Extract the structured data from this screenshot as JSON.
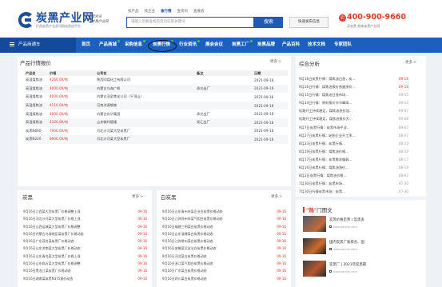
{
  "header": {
    "logo_name": "炭黑产业网",
    "logo_sub": "打造炭黑产业资讯网站首选平台",
    "slogan_line1": "炭黑资讯",
    "slogan_line2": "上炭黑产业网",
    "search_tabs": [
      "找产品",
      "找企业",
      "查行情",
      "查资讯",
      "查展会"
    ],
    "active_tab_index": 2,
    "search_placeholder": "请输入您要查找的资讯任意关键词",
    "search_button": "搜索",
    "publish_button": "快速发布信息",
    "phone": "400-900-9660",
    "phone_sub": "买炭黑 就来炭黑产业网",
    "phone_icon": "phone-icon"
  },
  "nav": {
    "category_label": "产品商通车",
    "items": [
      {
        "label": "首页",
        "new": false
      },
      {
        "label": "产品商城",
        "new": true
      },
      {
        "label": "采购信息",
        "new": true
      },
      {
        "label": "炭黑行情",
        "new": true
      },
      {
        "label": "行业资讯",
        "new": true
      },
      {
        "label": "展会会议",
        "new": false
      },
      {
        "label": "炭黑工厂",
        "new": true
      },
      {
        "label": "炭黑品牌",
        "new": false
      },
      {
        "label": "产品百科",
        "new": false
      },
      {
        "label": "技术文档",
        "new": false
      },
      {
        "label": "专家团队",
        "new": false
      }
    ],
    "highlighted_index": 3
  },
  "price_panel": {
    "title": "产品行情报价",
    "more": "更多 >",
    "columns": [
      "产品名",
      "价格",
      "公司名",
      "备注",
      "日期"
    ],
    "rows": [
      [
        "高温煤焦油",
        "4260.00/吨",
        "陕西同煤化工有限公司",
        "",
        "2021-09-16"
      ],
      [
        "高温煤焦油",
        "4000.00/吨",
        "内蒙古乌海广辉",
        "承兑出厂",
        "2021-09-16"
      ],
      [
        "高温煤焦油",
        "4000.00/吨",
        "内蒙古亚泉焦化公司（平顶山）",
        "",
        "2021-09-16"
      ],
      [
        "高温煤焦油",
        "4110.00/吨",
        "河南济源钢铁",
        "",
        "2021-09-16"
      ],
      [
        "高温煤焦油",
        "4000.00/吨",
        "内蒙古庆华集团",
        "承兑出厂",
        "2021-09-16"
      ],
      [
        "高温煤焦油",
        "4326.00/吨",
        "山东微利德隆",
        "现汇出厂",
        "2021-09-16"
      ],
      [
        "炭黑N660",
        "7900.00/吨",
        "河北沙河某大型炭黑厂",
        "",
        "2021-09-16"
      ],
      [
        "炭黑N220",
        "8900.00/吨",
        "河北沙河某大型炭黑厂",
        "",
        "2021-09-16"
      ]
    ]
  },
  "summary_panel": {
    "title": "综合分析",
    "more": "更多 >",
    "items": [
      {
        "title": "9月16日炭黑行情：煤焦油日涨，炭...",
        "date": "09-16"
      },
      {
        "title": "9月16日行情：煤焦油报价普遍涨价...",
        "date": "09-16"
      },
      {
        "title": "9月15日行情：煤焦油日涨市场...",
        "date": "09-15"
      },
      {
        "title": "9月14日行情：原料报价节节攀高...",
        "date": "09-14"
      },
      {
        "title": "松散开工持续稳定，煤焦油涨价加...",
        "date": "09-07"
      },
      {
        "title": "松散开工持续稳定，煤焦油报价大...",
        "date": "09-08"
      },
      {
        "title": "9月7日炭黑行情：炭黑市场平淡...",
        "date": "09-07"
      },
      {
        "title": "8月27日炭黑行情：轮胎企业开工率...",
        "date": "08-27"
      },
      {
        "title": "8月23日炭黑行情：炭黑行情...",
        "date": "08-23"
      },
      {
        "title": "8月19日炭黑行情：煤焦油价格...",
        "date": "08-19"
      },
      {
        "title": "8月17日炭黑行情：炭黑需求偏弱...",
        "date": "08-17"
      },
      {
        "title": "8月16日炭黑行情：煤焦油涨价...",
        "date": "08-16"
      },
      {
        "title": "8月2日炭黑行情：煤焦油价格...",
        "date": "08-02"
      },
      {
        "title": "7月30日炭黑行情：炭黑市场...",
        "date": "07-30"
      },
      {
        "title": "7月30日行情炭黑市场：炭黑...",
        "date": "07-30"
      }
    ]
  },
  "carbon_black_panel": {
    "title": "炭黑",
    "more": "更多 >",
    "items": [
      {
        "title": "9月16日江西某大型炭黑厂价格调整上涨",
        "date": "09-16"
      },
      {
        "title": "9月16日河北沙河某大型炭黑厂价格上涨",
        "date": "09-16"
      },
      {
        "title": "9月16日山西运城某大型炭黑厂价格调整",
        "date": "09-16"
      },
      {
        "title": "9月16日内蒙古乌海地区某炭黑厂价格动态",
        "date": "09-16"
      },
      {
        "title": "9月16日广东茂名某炭黑厂价格动态",
        "date": "09-16"
      },
      {
        "title": "9月16日山东济南某大型炭黑厂价格动态",
        "date": "09-16"
      },
      {
        "title": "9月16日山东青岛某大型炭黑厂价格上涨",
        "date": "09-16"
      },
      {
        "title": "9月16日山东临沂某大型炭黑厂价格调整",
        "date": "09-16"
      },
      {
        "title": "9月16日黑龙江某炭黑厂价格动态",
        "date": "09-16"
      },
      {
        "title": "9月16日湖南某炭黑N375报价动态",
        "date": "09-16"
      }
    ]
  },
  "white_carbon_panel": {
    "title": "白炭黑",
    "more": "更多 >",
    "items": [
      {
        "title": "9月16日山东青州市某企业白炭黑价格动态",
        "date": "09-16"
      },
      {
        "title": "9月16日江苏徐州市某气相白炭黑价格动态",
        "date": "09-16"
      },
      {
        "title": "9月16日福建三明某白炭黑价格动态",
        "date": "09-16"
      },
      {
        "title": "9月16日山东淄博某白炭黑价格动态",
        "date": "09-16"
      },
      {
        "title": "9月16日江苏常州某白炭黑价格动态",
        "date": "09-16"
      },
      {
        "title": "9月16日安徽某沉淀法白炭黑价格动态",
        "date": "09-16"
      },
      {
        "title": "9月16日河北某白炭黑价格动态",
        "date": "09-16"
      },
      {
        "title": "9月16日浙江某气相白炭黑价格动态",
        "date": "09-16"
      },
      {
        "title": "9月16日广东某白炭黑价格动态",
        "date": "09-16"
      },
      {
        "title": "9月16日四川某白炭黑价格动态",
        "date": "09-16"
      }
    ]
  },
  "hot_panel": {
    "title_prefix": "\"热\"",
    "title_suffix": "门图文",
    "items": [
      {
        "text": "炭黑价格走势 | 炭黑多",
        "source": "www.tanhei.com"
      },
      {
        "text": "国内炭黑厂家排名、国",
        "source": "www.tanhei.com"
      },
      {
        "text": "炭黑厂 | 2021年炭黑最",
        "source": "www.tanhei.com"
      }
    ]
  },
  "colors": {
    "brand_blue": "#1b5fbf",
    "price_red": "#e0322b",
    "new_dot_green": "#3ec93e"
  }
}
